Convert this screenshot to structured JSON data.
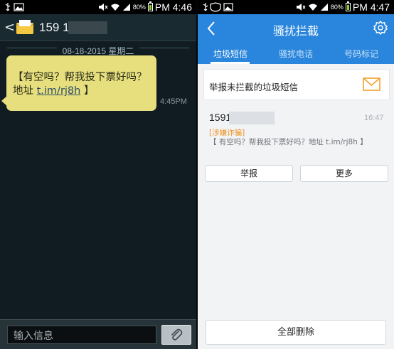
{
  "left_phone": {
    "status": {
      "time": "PM 4:46",
      "battery": "80%"
    },
    "header": {
      "contact_number": "159 1"
    },
    "date_separator": "08-18-2015 星期二",
    "message": {
      "text_before_link": "【有空吗？帮我投下票好吗？地址 ",
      "link": "t.im/rj8h",
      "text_after_link": " 】",
      "time": "4:45PM"
    },
    "input": {
      "placeholder": "输入信息"
    }
  },
  "right_phone": {
    "status": {
      "time": "PM 4:47",
      "battery": "80%"
    },
    "header": {
      "title": "骚扰拦截"
    },
    "tabs": [
      {
        "label": "垃圾短信",
        "active": true
      },
      {
        "label": "骚扰电话",
        "active": false
      },
      {
        "label": "号码标记",
        "active": false
      }
    ],
    "report_row": {
      "label": "举报未拦截的垃圾短信"
    },
    "sms_card": {
      "number": "1591",
      "time": "16:47",
      "tag": "[涉嫌诈骗]",
      "content": "【 有空吗？帮我投下票好吗？地址 t.im/rj8h 】",
      "buttons": {
        "report": "举报",
        "more": "更多"
      }
    },
    "delete_all": "全部删除"
  },
  "colors": {
    "accent_blue": "#2a86dc",
    "bubble_yellow": "#e7df7e",
    "warning_orange": "#f0921e",
    "dark_background": "#111c22"
  },
  "icons": [
    "usb-icon",
    "image-icon",
    "mute-icon",
    "wifi-icon",
    "signal-icon",
    "battery-icon",
    "back-icon",
    "envelope-icon",
    "paperclip-icon",
    "gear-icon",
    "mail-icon",
    "shield-icon"
  ]
}
